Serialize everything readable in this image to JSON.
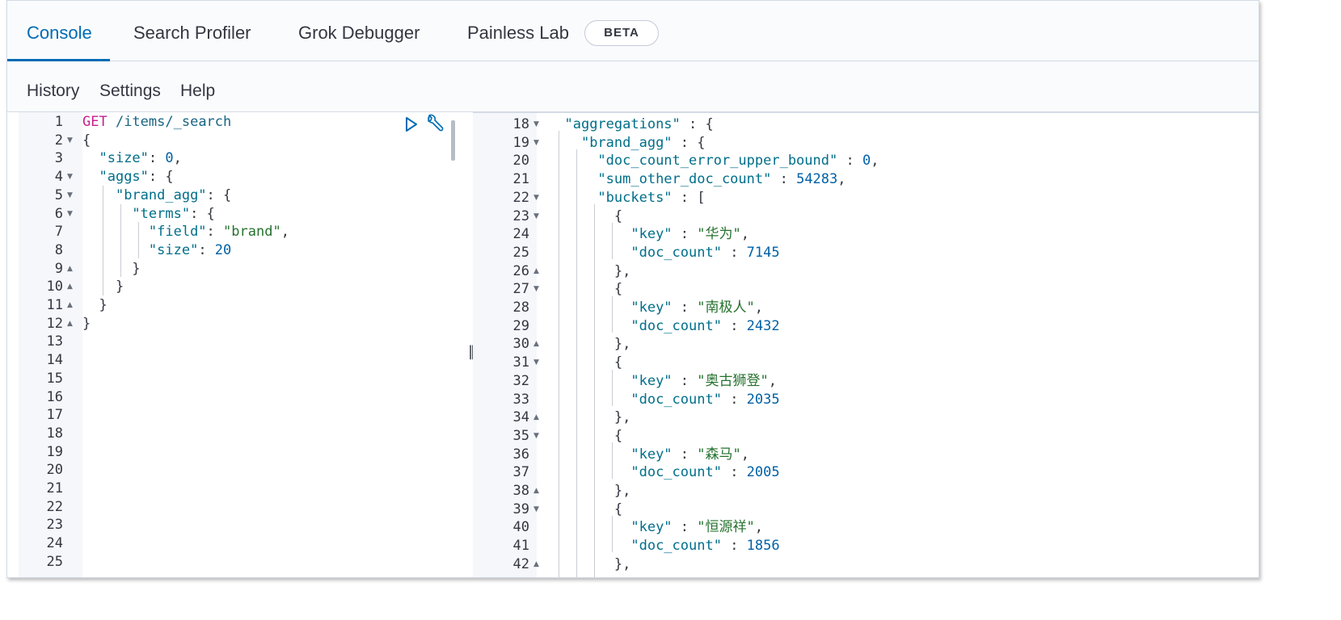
{
  "tabs": [
    {
      "label": "Console",
      "active": true
    },
    {
      "label": "Search Profiler",
      "active": false
    },
    {
      "label": "Grok Debugger",
      "active": false
    },
    {
      "label": "Painless Lab",
      "active": false
    }
  ],
  "beta_badge": "BETA",
  "menu": [
    "History",
    "Settings",
    "Help"
  ],
  "request_editor": {
    "lines": [
      {
        "n": "1",
        "fold": "",
        "tokens": [
          {
            "t": "GET",
            "c": "method"
          },
          {
            "t": " ",
            "c": "punc"
          },
          {
            "t": "/items/_search",
            "c": "url"
          }
        ]
      },
      {
        "n": "2",
        "fold": "open",
        "tokens": [
          {
            "t": "{",
            "c": "punc"
          }
        ]
      },
      {
        "n": "3",
        "fold": "",
        "tokens": [
          {
            "t": "  ",
            "c": "punc"
          },
          {
            "t": "\"size\"",
            "c": "key"
          },
          {
            "t": ": ",
            "c": "punc"
          },
          {
            "t": "0",
            "c": "num"
          },
          {
            "t": ",",
            "c": "punc"
          }
        ]
      },
      {
        "n": "4",
        "fold": "open",
        "tokens": [
          {
            "t": "  ",
            "c": "punc"
          },
          {
            "t": "\"aggs\"",
            "c": "key"
          },
          {
            "t": ": {",
            "c": "punc"
          }
        ]
      },
      {
        "n": "5",
        "fold": "open",
        "tokens": [
          {
            "t": "    ",
            "c": "punc"
          },
          {
            "t": "\"brand_agg\"",
            "c": "key"
          },
          {
            "t": ": {",
            "c": "punc"
          }
        ]
      },
      {
        "n": "6",
        "fold": "open",
        "tokens": [
          {
            "t": "      ",
            "c": "punc"
          },
          {
            "t": "\"terms\"",
            "c": "key"
          },
          {
            "t": ": {",
            "c": "punc"
          }
        ]
      },
      {
        "n": "7",
        "fold": "",
        "tokens": [
          {
            "t": "        ",
            "c": "punc"
          },
          {
            "t": "\"field\"",
            "c": "key"
          },
          {
            "t": ": ",
            "c": "punc"
          },
          {
            "t": "\"brand\"",
            "c": "str"
          },
          {
            "t": ",",
            "c": "punc"
          }
        ]
      },
      {
        "n": "8",
        "fold": "",
        "tokens": [
          {
            "t": "        ",
            "c": "punc"
          },
          {
            "t": "\"size\"",
            "c": "key"
          },
          {
            "t": ": ",
            "c": "punc"
          },
          {
            "t": "20",
            "c": "num"
          }
        ]
      },
      {
        "n": "9",
        "fold": "close",
        "tokens": [
          {
            "t": "      }",
            "c": "punc"
          }
        ]
      },
      {
        "n": "10",
        "fold": "close",
        "tokens": [
          {
            "t": "    }",
            "c": "punc"
          }
        ]
      },
      {
        "n": "11",
        "fold": "close",
        "tokens": [
          {
            "t": "  }",
            "c": "punc"
          }
        ]
      },
      {
        "n": "12",
        "fold": "close",
        "tokens": [
          {
            "t": "}",
            "c": "punc"
          }
        ]
      },
      {
        "n": "13",
        "fold": "",
        "tokens": []
      },
      {
        "n": "14",
        "fold": "",
        "tokens": []
      },
      {
        "n": "15",
        "fold": "",
        "tokens": []
      },
      {
        "n": "16",
        "fold": "",
        "tokens": []
      },
      {
        "n": "17",
        "fold": "",
        "tokens": []
      },
      {
        "n": "18",
        "fold": "",
        "tokens": []
      },
      {
        "n": "19",
        "fold": "",
        "tokens": []
      },
      {
        "n": "20",
        "fold": "",
        "tokens": []
      },
      {
        "n": "21",
        "fold": "",
        "tokens": []
      },
      {
        "n": "22",
        "fold": "",
        "tokens": []
      },
      {
        "n": "23",
        "fold": "",
        "tokens": []
      },
      {
        "n": "24",
        "fold": "",
        "tokens": []
      },
      {
        "n": "25",
        "fold": "",
        "tokens": []
      }
    ]
  },
  "response_editor": {
    "lines": [
      {
        "n": "18",
        "fold": "open",
        "tokens": [
          {
            "t": "  ",
            "c": "punc"
          },
          {
            "t": "\"aggregations\"",
            "c": "key"
          },
          {
            "t": " : {",
            "c": "punc"
          }
        ]
      },
      {
        "n": "19",
        "fold": "open",
        "tokens": [
          {
            "t": "    ",
            "c": "punc"
          },
          {
            "t": "\"brand_agg\"",
            "c": "key"
          },
          {
            "t": " : {",
            "c": "punc"
          }
        ]
      },
      {
        "n": "20",
        "fold": "",
        "tokens": [
          {
            "t": "      ",
            "c": "punc"
          },
          {
            "t": "\"doc_count_error_upper_bound\"",
            "c": "key"
          },
          {
            "t": " : ",
            "c": "punc"
          },
          {
            "t": "0",
            "c": "num"
          },
          {
            "t": ",",
            "c": "punc"
          }
        ]
      },
      {
        "n": "21",
        "fold": "",
        "tokens": [
          {
            "t": "      ",
            "c": "punc"
          },
          {
            "t": "\"sum_other_doc_count\"",
            "c": "key"
          },
          {
            "t": " : ",
            "c": "punc"
          },
          {
            "t": "54283",
            "c": "num"
          },
          {
            "t": ",",
            "c": "punc"
          }
        ]
      },
      {
        "n": "22",
        "fold": "open",
        "tokens": [
          {
            "t": "      ",
            "c": "punc"
          },
          {
            "t": "\"buckets\"",
            "c": "key"
          },
          {
            "t": " : [",
            "c": "punc"
          }
        ]
      },
      {
        "n": "23",
        "fold": "open",
        "tokens": [
          {
            "t": "        {",
            "c": "punc"
          }
        ]
      },
      {
        "n": "24",
        "fold": "",
        "tokens": [
          {
            "t": "          ",
            "c": "punc"
          },
          {
            "t": "\"key\"",
            "c": "key"
          },
          {
            "t": " : ",
            "c": "punc"
          },
          {
            "t": "\"华为\"",
            "c": "str"
          },
          {
            "t": ",",
            "c": "punc"
          }
        ]
      },
      {
        "n": "25",
        "fold": "",
        "tokens": [
          {
            "t": "          ",
            "c": "punc"
          },
          {
            "t": "\"doc_count\"",
            "c": "key"
          },
          {
            "t": " : ",
            "c": "punc"
          },
          {
            "t": "7145",
            "c": "num"
          }
        ]
      },
      {
        "n": "26",
        "fold": "close",
        "tokens": [
          {
            "t": "        },",
            "c": "punc"
          }
        ]
      },
      {
        "n": "27",
        "fold": "open",
        "tokens": [
          {
            "t": "        {",
            "c": "punc"
          }
        ]
      },
      {
        "n": "28",
        "fold": "",
        "tokens": [
          {
            "t": "          ",
            "c": "punc"
          },
          {
            "t": "\"key\"",
            "c": "key"
          },
          {
            "t": " : ",
            "c": "punc"
          },
          {
            "t": "\"南极人\"",
            "c": "str"
          },
          {
            "t": ",",
            "c": "punc"
          }
        ]
      },
      {
        "n": "29",
        "fold": "",
        "tokens": [
          {
            "t": "          ",
            "c": "punc"
          },
          {
            "t": "\"doc_count\"",
            "c": "key"
          },
          {
            "t": " : ",
            "c": "punc"
          },
          {
            "t": "2432",
            "c": "num"
          }
        ]
      },
      {
        "n": "30",
        "fold": "close",
        "tokens": [
          {
            "t": "        },",
            "c": "punc"
          }
        ]
      },
      {
        "n": "31",
        "fold": "open",
        "tokens": [
          {
            "t": "        {",
            "c": "punc"
          }
        ]
      },
      {
        "n": "32",
        "fold": "",
        "tokens": [
          {
            "t": "          ",
            "c": "punc"
          },
          {
            "t": "\"key\"",
            "c": "key"
          },
          {
            "t": " : ",
            "c": "punc"
          },
          {
            "t": "\"奥古狮登\"",
            "c": "str"
          },
          {
            "t": ",",
            "c": "punc"
          }
        ]
      },
      {
        "n": "33",
        "fold": "",
        "tokens": [
          {
            "t": "          ",
            "c": "punc"
          },
          {
            "t": "\"doc_count\"",
            "c": "key"
          },
          {
            "t": " : ",
            "c": "punc"
          },
          {
            "t": "2035",
            "c": "num"
          }
        ]
      },
      {
        "n": "34",
        "fold": "close",
        "tokens": [
          {
            "t": "        },",
            "c": "punc"
          }
        ]
      },
      {
        "n": "35",
        "fold": "open",
        "tokens": [
          {
            "t": "        {",
            "c": "punc"
          }
        ]
      },
      {
        "n": "36",
        "fold": "",
        "tokens": [
          {
            "t": "          ",
            "c": "punc"
          },
          {
            "t": "\"key\"",
            "c": "key"
          },
          {
            "t": " : ",
            "c": "punc"
          },
          {
            "t": "\"森马\"",
            "c": "str"
          },
          {
            "t": ",",
            "c": "punc"
          }
        ]
      },
      {
        "n": "37",
        "fold": "",
        "tokens": [
          {
            "t": "          ",
            "c": "punc"
          },
          {
            "t": "\"doc_count\"",
            "c": "key"
          },
          {
            "t": " : ",
            "c": "punc"
          },
          {
            "t": "2005",
            "c": "num"
          }
        ]
      },
      {
        "n": "38",
        "fold": "close",
        "tokens": [
          {
            "t": "        },",
            "c": "punc"
          }
        ]
      },
      {
        "n": "39",
        "fold": "open",
        "tokens": [
          {
            "t": "        {",
            "c": "punc"
          }
        ]
      },
      {
        "n": "40",
        "fold": "",
        "tokens": [
          {
            "t": "          ",
            "c": "punc"
          },
          {
            "t": "\"key\"",
            "c": "key"
          },
          {
            "t": " : ",
            "c": "punc"
          },
          {
            "t": "\"恒源祥\"",
            "c": "str"
          },
          {
            "t": ",",
            "c": "punc"
          }
        ]
      },
      {
        "n": "41",
        "fold": "",
        "tokens": [
          {
            "t": "          ",
            "c": "punc"
          },
          {
            "t": "\"doc_count\"",
            "c": "key"
          },
          {
            "t": " : ",
            "c": "punc"
          },
          {
            "t": "1856",
            "c": "num"
          }
        ]
      },
      {
        "n": "42",
        "fold": "close",
        "tokens": [
          {
            "t": "        },",
            "c": "punc"
          }
        ]
      }
    ]
  },
  "icons": {
    "run": "play-icon",
    "actions": "wrench-icon",
    "divider": "resize-handle-icon"
  },
  "colors": {
    "accent": "#006bb4",
    "method": "#c61e8c",
    "key": "#006e8a",
    "string": "#25722e",
    "number": "#0061a6"
  }
}
